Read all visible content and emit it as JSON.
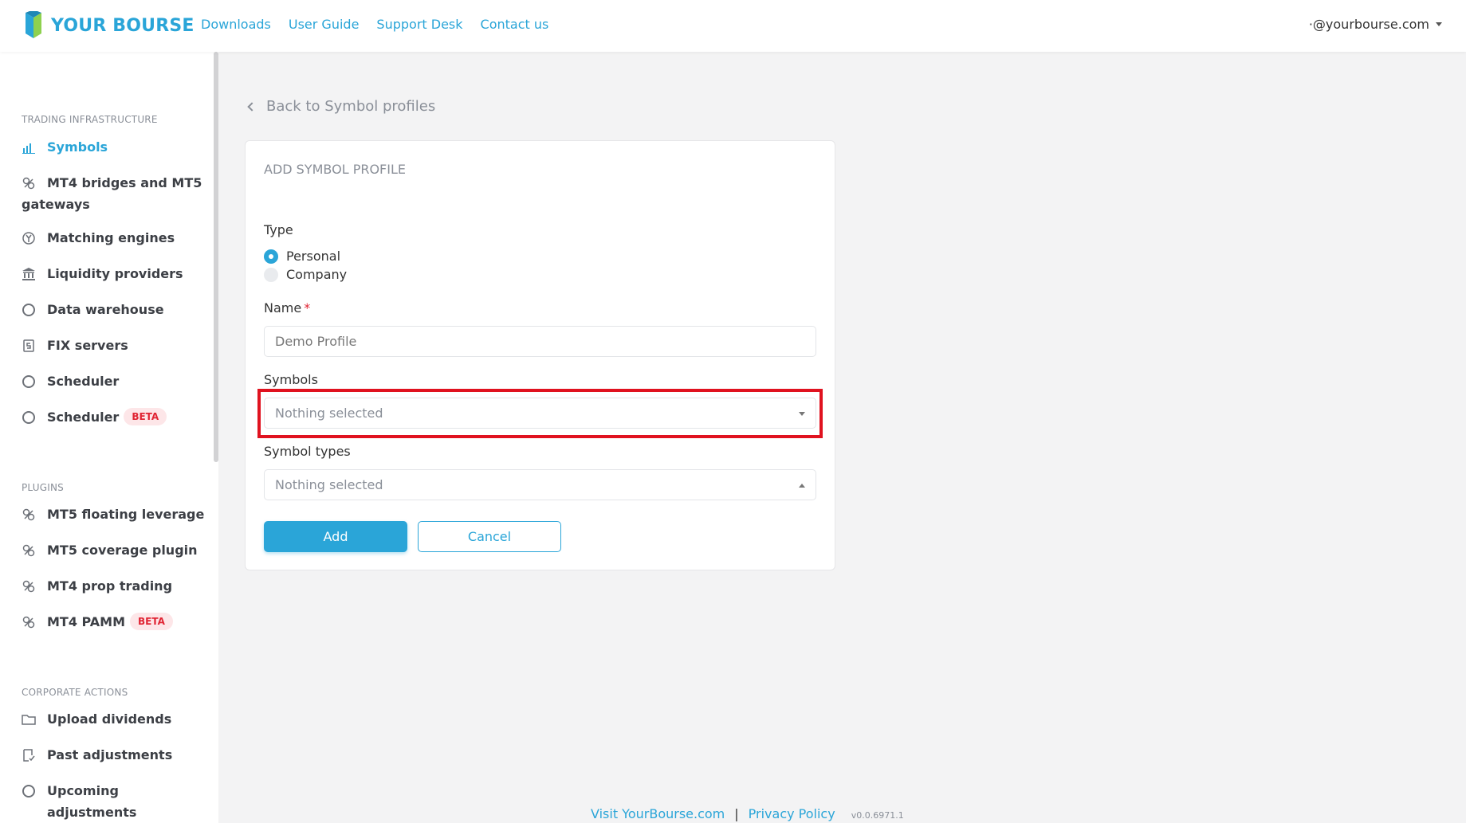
{
  "brand": {
    "name": "YOUR BOURSE",
    "accent": "#2aa5d8",
    "danger": "#e02433"
  },
  "topnav": [
    "Downloads",
    "User Guide",
    "Support Desk",
    "Contact us"
  ],
  "user": {
    "email": "·@yourbourse.com"
  },
  "sidebar": {
    "sections": [
      {
        "title": "TRADING INFRASTRUCTURE"
      },
      {
        "title": "PLUGINS"
      },
      {
        "title": "CORPORATE ACTIONS"
      }
    ],
    "items": [
      {
        "label": "Symbols",
        "icon": "bar-chart-icon"
      },
      {
        "label": "MT4 bridges and MT5 gateways",
        "icon": "link-icon"
      },
      {
        "label": "Matching engines",
        "icon": "matching-icon"
      },
      {
        "label": "Liquidity providers",
        "icon": "bank-icon"
      },
      {
        "label": "Data warehouse",
        "icon": "circle-icon"
      },
      {
        "label": "FIX servers",
        "icon": "fix-icon"
      },
      {
        "label": "Scheduler",
        "icon": "circle-icon"
      },
      {
        "label": "Scheduler",
        "icon": "circle-icon",
        "badge": "BETA"
      },
      {
        "label": "MT5 floating leverage",
        "icon": "link-icon"
      },
      {
        "label": "MT5 coverage plugin",
        "icon": "link-icon"
      },
      {
        "label": "MT4 prop trading",
        "icon": "link-icon"
      },
      {
        "label": "MT4 PAMM",
        "icon": "link-icon",
        "badge": "BETA"
      },
      {
        "label": "Upload dividends",
        "icon": "folder-icon"
      },
      {
        "label": "Past adjustments",
        "icon": "checklist-icon"
      },
      {
        "label": "Upcoming adjustments",
        "icon": "circle-icon"
      }
    ]
  },
  "main": {
    "back_label": "Back to Symbol profiles",
    "card_title": "ADD SYMBOL PROFILE",
    "type_label": "Type",
    "type_options": [
      "Personal",
      "Company"
    ],
    "type_selected": "Personal",
    "name_label": "Name",
    "name_required": "*",
    "name_value": "Demo Profile",
    "symbols_label": "Symbols",
    "symbols_value": "Nothing selected",
    "symbol_types_label": "Symbol types",
    "symbol_types_value": "Nothing selected",
    "add_label": "Add",
    "cancel_label": "Cancel"
  },
  "footer": {
    "visit_label": "Visit YourBourse.com",
    "separator": "|",
    "privacy_label": "Privacy Policy",
    "version": "v0.0.6971.1"
  }
}
